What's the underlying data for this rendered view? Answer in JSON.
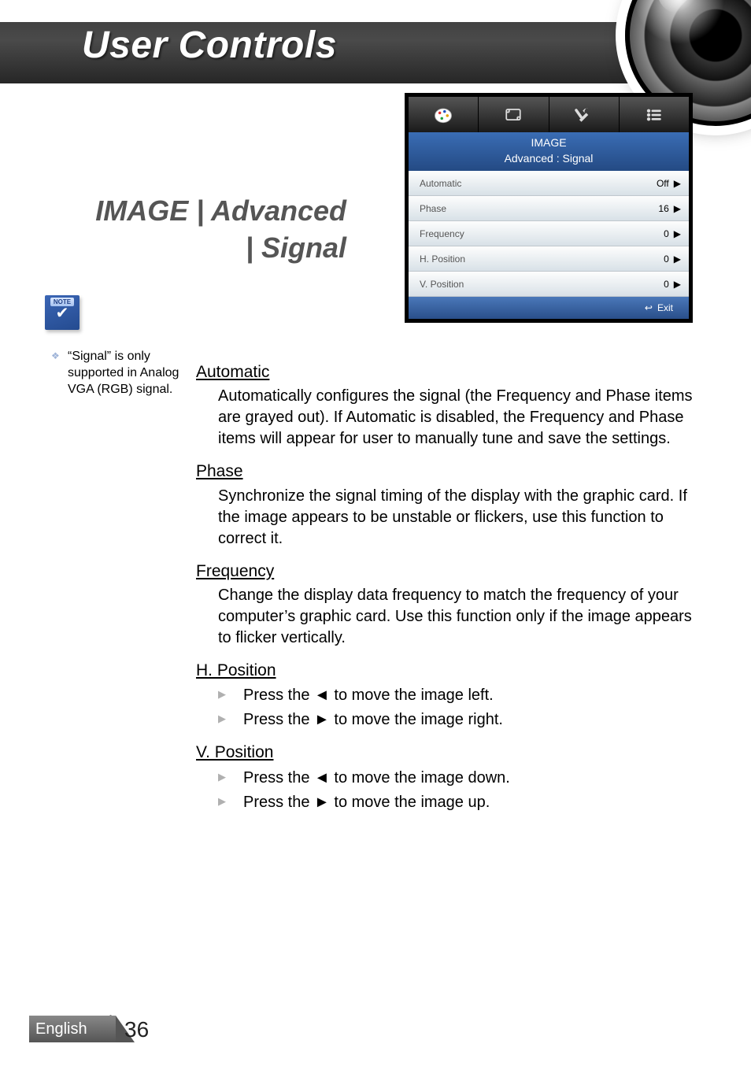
{
  "header": {
    "title": "User Controls"
  },
  "section_title": {
    "line1": "IMAGE | Advanced",
    "line2": "| Signal"
  },
  "note": {
    "badge_label": "NOTE",
    "text": "“Signal” is only supported in Analog VGA (RGB) signal."
  },
  "osd": {
    "title": "IMAGE",
    "subtitle": "Advanced : Signal",
    "rows": [
      {
        "label": "Automatic",
        "value": "Off"
      },
      {
        "label": "Phase",
        "value": "16"
      },
      {
        "label": "Frequency",
        "value": "0"
      },
      {
        "label": "H. Position",
        "value": "0"
      },
      {
        "label": "V. Position",
        "value": "0"
      }
    ],
    "exit": "Exit"
  },
  "body": {
    "automatic": {
      "heading": "Automatic",
      "text": "Automatically configures the signal (the Frequency and Phase items are grayed out). If Automatic is disabled, the Frequency and Phase items will appear for user to manually tune and save the settings."
    },
    "phase": {
      "heading": "Phase",
      "text": "Synchronize the signal timing of the display with the graphic card. If the image appears to be unstable or flickers, use this function to correct it."
    },
    "frequency": {
      "heading": "Frequency",
      "text": "Change the display data frequency to match the frequency of your computer’s graphic card. Use this function only if the image appears to flicker vertically."
    },
    "hpos": {
      "heading": "H. Position",
      "items": [
        "Press the ◄ to move the image left.",
        "Press the ► to move the image right."
      ]
    },
    "vpos": {
      "heading": "V. Position",
      "items": [
        "Press the ◄ to move the image down.",
        "Press the ► to move the image up."
      ]
    }
  },
  "footer": {
    "language": "English",
    "page": "36"
  }
}
